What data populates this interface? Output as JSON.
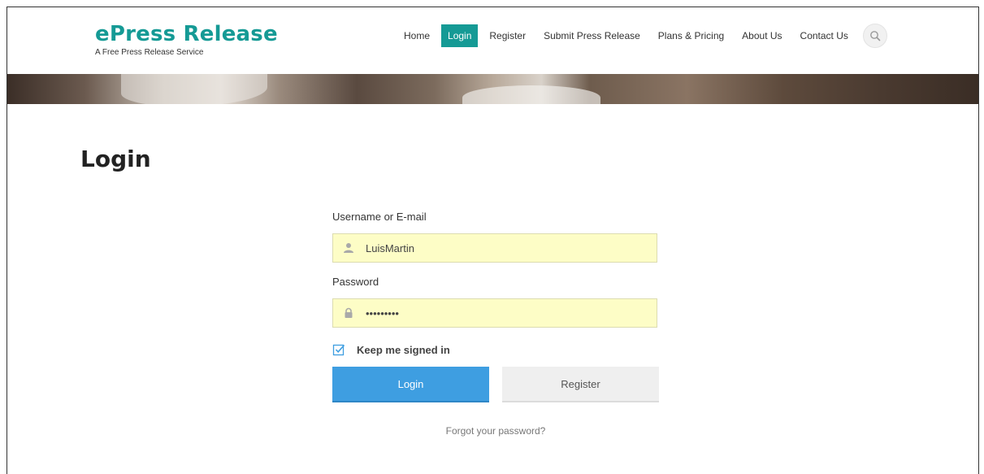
{
  "brand": {
    "title": "ePress Release",
    "tagline": "A Free Press Release Service",
    "color": "#159a95"
  },
  "nav": {
    "items": [
      {
        "label": "Home",
        "active": false
      },
      {
        "label": "Login",
        "active": true
      },
      {
        "label": "Register",
        "active": false
      },
      {
        "label": "Submit Press Release",
        "active": false
      },
      {
        "label": "Plans & Pricing",
        "active": false
      },
      {
        "label": "About Us",
        "active": false
      },
      {
        "label": "Contact Us",
        "active": false
      }
    ],
    "search_icon": "search-icon"
  },
  "page": {
    "title": "Login"
  },
  "form": {
    "username_label": "Username or E-mail",
    "username_value": "LuisMartin",
    "username_icon": "user-icon",
    "password_label": "Password",
    "password_value": "•••••••••",
    "password_icon": "lock-icon",
    "remember_label": "Keep me signed in",
    "remember_checked": true,
    "login_button": "Login",
    "register_button": "Register",
    "forgot_link": "Forgot your password?"
  },
  "colors": {
    "accent": "#159a95",
    "primary_button": "#3e9ee1",
    "input_bg": "#fdfdc6"
  }
}
